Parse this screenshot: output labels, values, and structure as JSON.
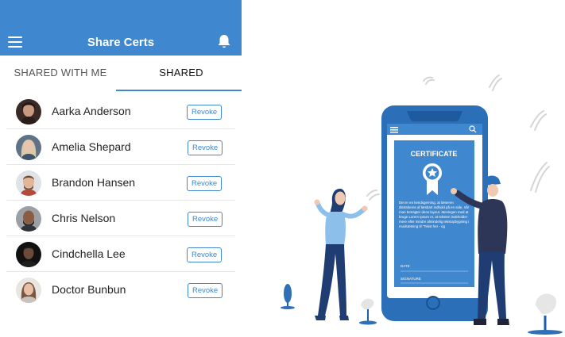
{
  "app": {
    "title": "Share Certs",
    "menu_icon": "hamburger-menu-icon",
    "notification_icon": "bell-icon",
    "accent_color": "#3f88cf"
  },
  "tabs": [
    {
      "label": "SHARED WITH ME",
      "active": false
    },
    {
      "label": "SHARED",
      "active": true
    }
  ],
  "contacts": [
    {
      "name": "Aarka Anderson",
      "action": "Revoke"
    },
    {
      "name": "Amelia Shepard",
      "action": "Revoke"
    },
    {
      "name": "Brandon Hansen",
      "action": "Revoke"
    },
    {
      "name": "Chris Nelson",
      "action": "Revoke"
    },
    {
      "name": "Cindchella Lee",
      "action": "Revoke"
    },
    {
      "name": "Doctor Bunbun",
      "action": "Revoke"
    }
  ],
  "illustration": {
    "certificate_heading": "CERTIFICATE",
    "certificate_body": "Det er en kendsgerning, at læseren distraheres af læsbart indhold på en side, når man betragter dens layout. Meningen med at bruge Lorem Ipsum er, at teksten indeholder mere eller mindre almindelig tekstopbygning i modsætning til \"Tekst her - og",
    "date_label": "DATE",
    "signature_label": "SIGNATURE"
  }
}
